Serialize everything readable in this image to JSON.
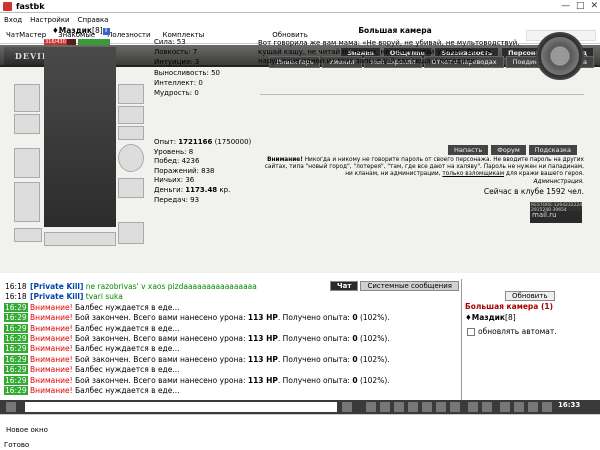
{
  "window": {
    "title": "fastbk"
  },
  "menu": {
    "items": [
      "Вход",
      "Настройки",
      "Справка"
    ]
  },
  "toolbar": {
    "items": [
      "ЧатМастер",
      "Знакомые",
      "Полезности",
      "Комплекты"
    ],
    "refresh": "Обновить"
  },
  "game": {
    "logo": "DEVILSCITY",
    "nav_top": [
      "Знания",
      "Общение",
      "Безопасность",
      "Персонаж",
      "Выход"
    ],
    "nav_bottom": [
      "Инвентарь",
      "Умения",
      "Мой Скроллл",
      "Отчет о переводах",
      "Поединки",
      "Анкета"
    ],
    "character": {
      "name": "Маздик",
      "level": "[8]",
      "hp": "316/430",
      "hp_fraction": 0.73
    },
    "stats": [
      "Сила: 53",
      "Ловкость: 7",
      "Интуиция: 3",
      "Выносливость: 50",
      "Интеллект: 0",
      "Мудрость: 0"
    ],
    "exp": {
      "label": "Опыт: ",
      "value": "1721166",
      "next": " (1750000)"
    },
    "stats2": [
      "Уровень: 8",
      "Побед: 4236",
      "Поражений: 838",
      "Ничьих: 36"
    ],
    "money": {
      "label": "Деньги: ",
      "value": "1173.48",
      "unit": " кр."
    },
    "transfers": "Передач: 93",
    "location": {
      "name": "Большая камера",
      "desc": "Вот говорила же вам мама: «Не воруй, не убивай, не мультоводствуй, кушай кашу, не читай по ночам, не прогуливай уроки». Вот за нарушение одной из этих заповедей вас сюда и посадили."
    },
    "buttons": [
      "Напасть",
      "Форум",
      "Подсказка"
    ],
    "warning": {
      "bold": "Внимание!",
      "text": " Никогда и никому не говорите пароль от своего персонажа. Не вводите пароль на других сайтах, типа \"новый город\", \"лотерея\", \"там, где все дают на халяву\". Пароль не нужен ни паладинам, ни кланам, ни администрации, ",
      "link": "только взломщикам",
      "tail": " для кражи вашего героя.",
      "sign": "Администрация."
    },
    "online": "Сейчас в клубе 1592 чел.",
    "counter": "RESTORE:1264232224 2915248 39654",
    "mailru": "mail.ru"
  },
  "chat": {
    "tabs": [
      "Чат",
      "Системные сообщения"
    ],
    "messages": [
      {
        "time": "16:18",
        "type": "pk",
        "who": "[Private Kill]",
        "text": " ne razobrivas' v xaos pizdaaaaaaaaaaaaaaaa"
      },
      {
        "time": "16:18",
        "type": "pk",
        "who": "[Private Kill]",
        "text": " tvari suka"
      },
      {
        "time": "16:29",
        "type": "warn",
        "who": "Внимание!",
        "text": " Балбес нуждается в еде..."
      },
      {
        "time": "16:29",
        "type": "fight",
        "who": "Внимание!",
        "text": " Бой закончен. Всего вами нанесено урона: ",
        "hp": "113 HP",
        "mid": ". Получено опыта: ",
        "exp": "0",
        "tail": " (102%)."
      },
      {
        "time": "16:29",
        "type": "warn",
        "who": "Внимание!",
        "text": " Балбес нуждается в еде..."
      },
      {
        "time": "16:29",
        "type": "fight",
        "who": "Внимание!",
        "text": " Бой закончен. Всего вами нанесено урона: ",
        "hp": "113 HP",
        "mid": ". Получено опыта: ",
        "exp": "0",
        "tail": " (102%)."
      },
      {
        "time": "16:29",
        "type": "warn",
        "who": "Внимание!",
        "text": " Балбес нуждается в еде..."
      },
      {
        "time": "16:29",
        "type": "fight",
        "who": "Внимание!",
        "text": " Бой закончен. Всего вами нанесено урона: ",
        "hp": "113 HP",
        "mid": ". Получено опыта: ",
        "exp": "0",
        "tail": " (102%)."
      },
      {
        "time": "16:29",
        "type": "warn",
        "who": "Внимание!",
        "text": " Балбес нуждается в еде..."
      },
      {
        "time": "16:29",
        "type": "fight",
        "who": "Внимание!",
        "text": " Бой закончен. Всего вами нанесено урона: ",
        "hp": "113 HP",
        "mid": ". Получено опыта: ",
        "exp": "0",
        "tail": " (102%)."
      },
      {
        "time": "16:29",
        "type": "warn",
        "who": "Внимание!",
        "text": " Балбес нуждается в еде..."
      }
    ]
  },
  "side": {
    "refresh": "Обновить",
    "title": "Большая камера (1)",
    "user": "Маздик",
    "user_level": "[8]",
    "auto": "обновлять автомат."
  },
  "clock": "16:33",
  "status": {
    "new_window": "Новое окно",
    "ready": "Готово"
  }
}
